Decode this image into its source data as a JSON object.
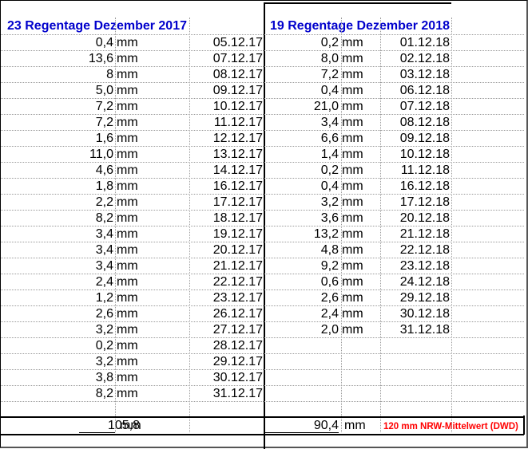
{
  "headers": {
    "h2017": "23 Regentage Dezember 2017",
    "h2018": "19 Regentage Dezember 2018"
  },
  "unit": "mm",
  "data2017": [
    {
      "v": "0,4",
      "d": "05.12.17"
    },
    {
      "v": "13,6",
      "d": "07.12.17"
    },
    {
      "v": "8",
      "d": "08.12.17"
    },
    {
      "v": "5,0",
      "d": "09.12.17"
    },
    {
      "v": "7,2",
      "d": "10.12.17"
    },
    {
      "v": "7,2",
      "d": "11.12.17"
    },
    {
      "v": "1,6",
      "d": "12.12.17"
    },
    {
      "v": "11,0",
      "d": "13.12.17"
    },
    {
      "v": "4,6",
      "d": "14.12.17"
    },
    {
      "v": "1,8",
      "d": "16.12.17"
    },
    {
      "v": "2,2",
      "d": "17.12.17"
    },
    {
      "v": "8,2",
      "d": "18.12.17"
    },
    {
      "v": "3,4",
      "d": "19.12.17"
    },
    {
      "v": "3,4",
      "d": "20.12.17"
    },
    {
      "v": "3,4",
      "d": "21.12.17"
    },
    {
      "v": "2,4",
      "d": "22.12.17"
    },
    {
      "v": "1,2",
      "d": "23.12.17"
    },
    {
      "v": "2,6",
      "d": "26.12.17"
    },
    {
      "v": "3,2",
      "d": "27.12.17"
    },
    {
      "v": "0,2",
      "d": "28.12.17"
    },
    {
      "v": "3,2",
      "d": "29.12.17"
    },
    {
      "v": "3,8",
      "d": "30.12.17"
    },
    {
      "v": "8,2",
      "d": "31.12.17"
    }
  ],
  "data2018": [
    {
      "v": "0,2",
      "d": "01.12.18"
    },
    {
      "v": "8,0",
      "d": "02.12.18"
    },
    {
      "v": "7,2",
      "d": "03.12.18"
    },
    {
      "v": "0,4",
      "d": "06.12.18"
    },
    {
      "v": "21,0",
      "d": "07.12.18"
    },
    {
      "v": "3,4",
      "d": "08.12.18"
    },
    {
      "v": "6,6",
      "d": "09.12.18"
    },
    {
      "v": "1,4",
      "d": "10.12.18"
    },
    {
      "v": "0,2",
      "d": "11.12.18"
    },
    {
      "v": "0,4",
      "d": "16.12.18"
    },
    {
      "v": "3,2",
      "d": "17.12.18"
    },
    {
      "v": "3,6",
      "d": "20.12.18"
    },
    {
      "v": "13,2",
      "d": "21.12.18"
    },
    {
      "v": "4,8",
      "d": "22.12.18"
    },
    {
      "v": "9,2",
      "d": "23.12.18"
    },
    {
      "v": "0,6",
      "d": "24.12.18"
    },
    {
      "v": "2,6",
      "d": "29.12.18"
    },
    {
      "v": "2,4",
      "d": "30.12.18"
    },
    {
      "v": "2,0",
      "d": "31.12.18"
    }
  ],
  "totals": {
    "t2017": "105,8",
    "t2018": "90,4",
    "unit": "mm",
    "note": "120 mm NRW-Mittelwert (DWD)"
  }
}
